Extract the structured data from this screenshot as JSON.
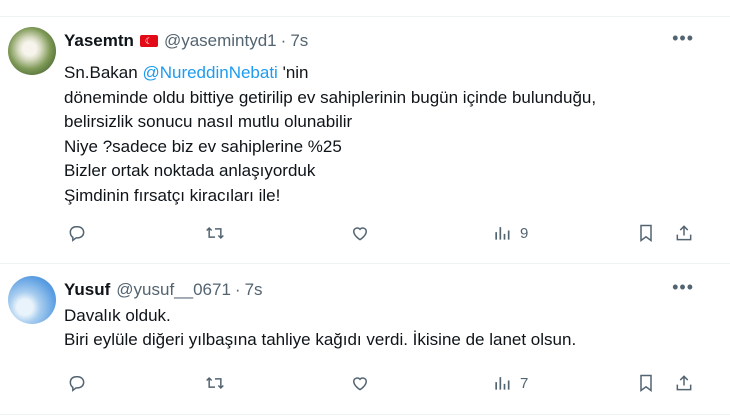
{
  "tweets": [
    {
      "name": "Yasemtn",
      "flag_icon": "turkey-flag-icon",
      "handle": "@yasemintyd1",
      "separator": "·",
      "time": "7s",
      "text_before": "Sn.Bakan ",
      "mention": "@NureddinNebati",
      "text_after": " 'nin\ndöneminde oldu bittiye getirilip ev sahiplerinin bugün içinde bulunduğu,\nbelirsizlik sonucu nasıl mutlu olunabilir\nNiye ?sadece biz ev sahiplerine %25\nBizler ortak noktada anlaşıyorduk\nŞimdinin fırsatçı kiracıları ile!",
      "views": "9",
      "more": "•••"
    },
    {
      "name": "Yusuf",
      "handle": "@yusuf__0671",
      "separator": "·",
      "time": "7s",
      "text": "Davalık olduk.\nBiri eylüle diğeri yılbaşına tahliye kağıdı verdi. İkisine de lanet olsun.",
      "views": "7",
      "more": "•••"
    }
  ],
  "icons": [
    "reply-icon",
    "retweet-icon",
    "like-icon",
    "views-icon",
    "bookmark-icon",
    "share-icon"
  ],
  "colors": {
    "link": "#1d9bf0",
    "muted": "#536471",
    "text": "#0f1419"
  }
}
